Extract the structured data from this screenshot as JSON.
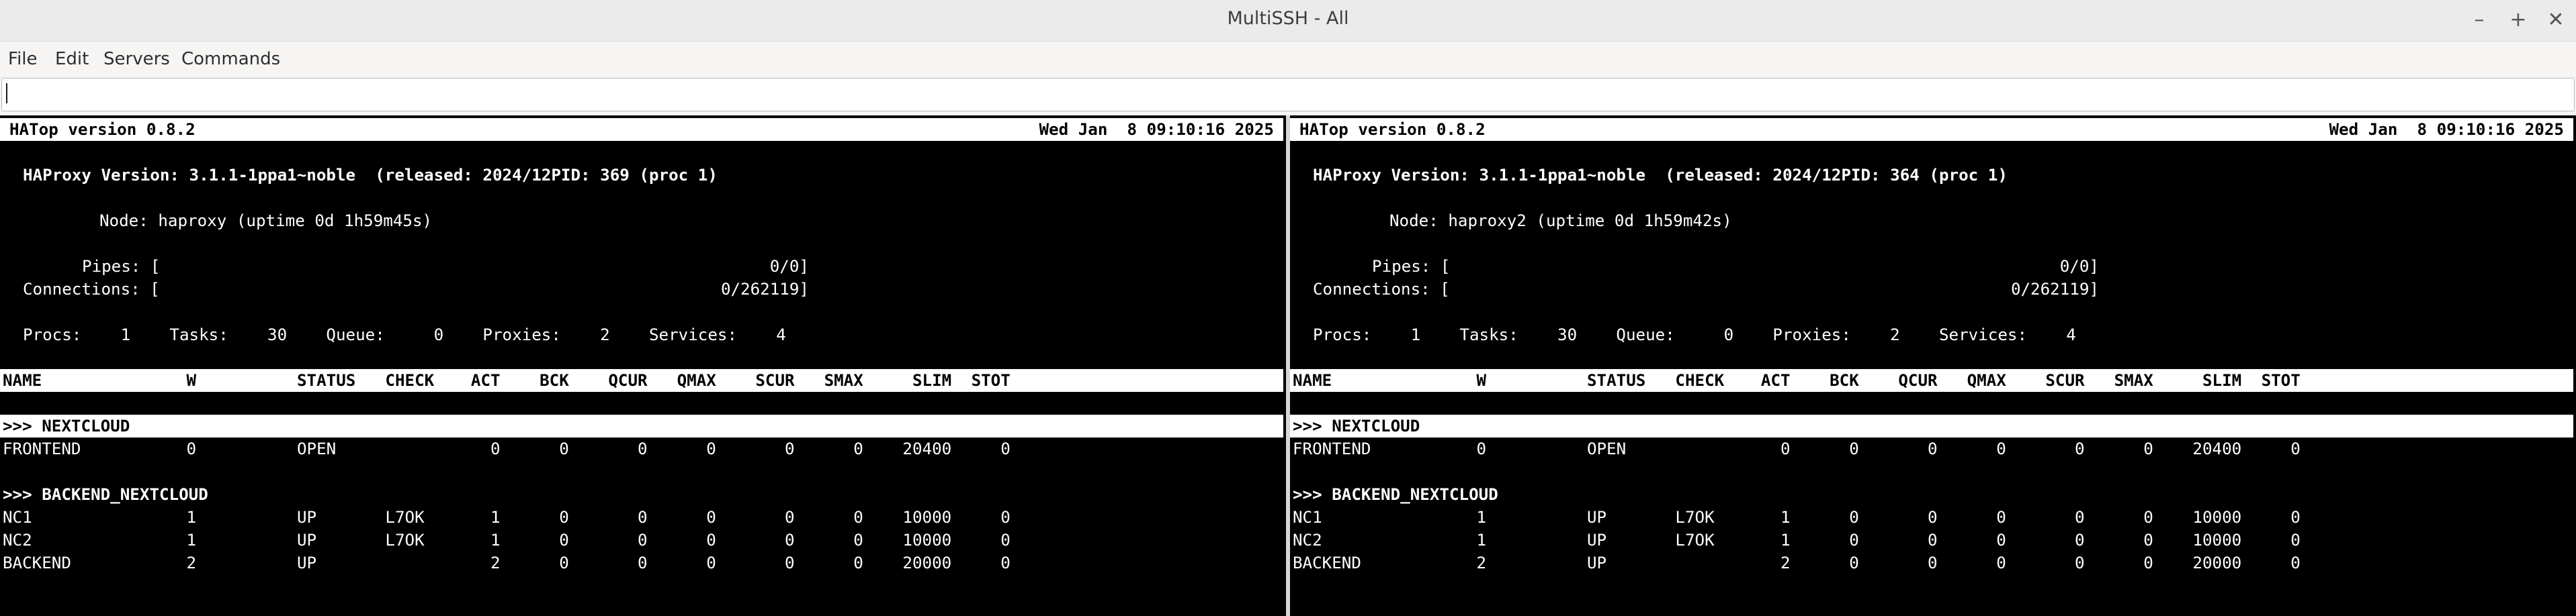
{
  "window": {
    "title": "MultiSSH - All",
    "minimize_icon": "minimize-icon",
    "maximize_icon": "maximize-icon",
    "close_icon": "close-icon"
  },
  "menu": {
    "file": "File",
    "edit": "Edit",
    "servers": "Servers",
    "commands": "Commands"
  },
  "command_input": {
    "value": ""
  },
  "panes": [
    {
      "header_left": "HATop version 0.8.2",
      "header_right": "Wed Jan  8 09:10:16 2025",
      "version_line": "HAProxy Version: 3.1.1-1ppa1~noble  (released: 2024/12PID: 369 (proc 1)",
      "node_line": "Node: haproxy (uptime 0d 1h59m45s)",
      "pipes_label": "Pipes: [",
      "pipes_value": "0/0]",
      "connections_label": "Connections: [",
      "connections_value": "0/262119]",
      "stats_line": "Procs:    1    Tasks:    30    Queue:     0    Proxies:    2    Services:    4",
      "columns": [
        "NAME",
        "W",
        "STATUS",
        "CHECK",
        "ACT",
        "BCK",
        "QCUR",
        "QMAX",
        "SCUR",
        "SMAX",
        "SLIM",
        "STOT"
      ],
      "sections": [
        {
          "title": ">>> NEXTCLOUD",
          "rows": [
            [
              "FRONTEND",
              "0",
              "OPEN",
              "",
              "0",
              "0",
              "0",
              "0",
              "0",
              "0",
              "20400",
              "0"
            ]
          ]
        },
        {
          "title": ">>> BACKEND_NEXTCLOUD",
          "rows": [
            [
              "NC1",
              "1",
              "UP",
              "L7OK",
              "1",
              "0",
              "0",
              "0",
              "0",
              "0",
              "10000",
              "0"
            ],
            [
              "NC2",
              "1",
              "UP",
              "L7OK",
              "1",
              "0",
              "0",
              "0",
              "0",
              "0",
              "10000",
              "0"
            ],
            [
              "BACKEND",
              "2",
              "UP",
              "",
              "2",
              "0",
              "0",
              "0",
              "0",
              "0",
              "20000",
              "0"
            ]
          ]
        }
      ]
    },
    {
      "header_left": "HATop version 0.8.2",
      "header_right": "Wed Jan  8 09:10:16 2025",
      "version_line": "HAProxy Version: 3.1.1-1ppa1~noble  (released: 2024/12PID: 364 (proc 1)",
      "node_line": "Node: haproxy2 (uptime 0d 1h59m42s)",
      "pipes_label": "Pipes: [",
      "pipes_value": "0/0]",
      "connections_label": "Connections: [",
      "connections_value": "0/262119]",
      "stats_line": "Procs:    1    Tasks:    30    Queue:     0    Proxies:    2    Services:    4",
      "columns": [
        "NAME",
        "W",
        "STATUS",
        "CHECK",
        "ACT",
        "BCK",
        "QCUR",
        "QMAX",
        "SCUR",
        "SMAX",
        "SLIM",
        "STOT"
      ],
      "sections": [
        {
          "title": ">>> NEXTCLOUD",
          "rows": [
            [
              "FRONTEND",
              "0",
              "OPEN",
              "",
              "0",
              "0",
              "0",
              "0",
              "0",
              "0",
              "20400",
              "0"
            ]
          ]
        },
        {
          "title": ">>> BACKEND_NEXTCLOUD",
          "rows": [
            [
              "NC1",
              "1",
              "UP",
              "L7OK",
              "1",
              "0",
              "0",
              "0",
              "0",
              "0",
              "10000",
              "0"
            ],
            [
              "NC2",
              "1",
              "UP",
              "L7OK",
              "1",
              "0",
              "0",
              "0",
              "0",
              "0",
              "10000",
              "0"
            ],
            [
              "BACKEND",
              "2",
              "UP",
              "",
              "2",
              "0",
              "0",
              "0",
              "0",
              "0",
              "20000",
              "0"
            ]
          ]
        }
      ]
    }
  ]
}
